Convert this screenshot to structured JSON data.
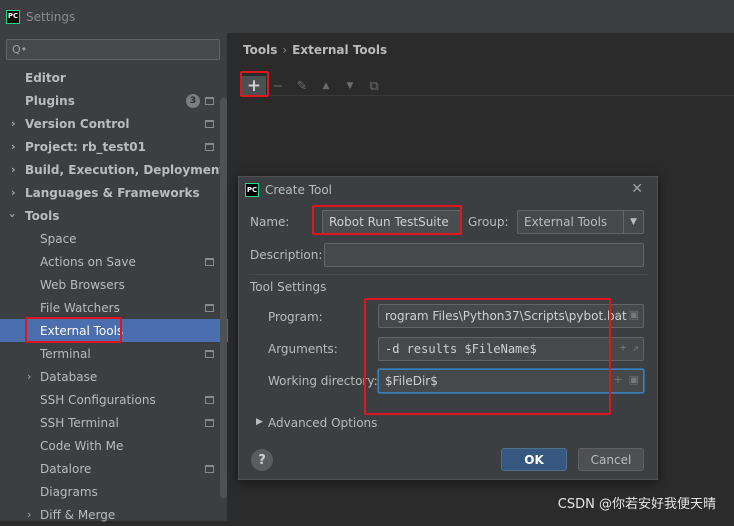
{
  "window": {
    "title": "Settings",
    "logo_text": "PC"
  },
  "search": {
    "placeholder": "Q•"
  },
  "sidebar": {
    "items": [
      {
        "label": "Editor"
      },
      {
        "label": "Plugins",
        "badge": "3"
      },
      {
        "label": "Version Control"
      },
      {
        "label": "Project: rb_test01"
      },
      {
        "label": "Build, Execution, Deployment"
      },
      {
        "label": "Languages & Frameworks"
      },
      {
        "label": "Tools"
      },
      {
        "label": "Space"
      },
      {
        "label": "Actions on Save"
      },
      {
        "label": "Web Browsers"
      },
      {
        "label": "File Watchers"
      },
      {
        "label": "External Tools"
      },
      {
        "label": "Terminal"
      },
      {
        "label": "Database"
      },
      {
        "label": "SSH Configurations"
      },
      {
        "label": "SSH Terminal"
      },
      {
        "label": "Code With Me"
      },
      {
        "label": "Datalore"
      },
      {
        "label": "Diagrams"
      },
      {
        "label": "Diff & Merge"
      }
    ]
  },
  "breadcrumb": {
    "parent": "Tools",
    "separator": "›",
    "current": "External Tools"
  },
  "toolbar": {
    "add": "+",
    "remove": "−",
    "edit": "✎",
    "up": "▲",
    "down": "▼",
    "copy": "⧉"
  },
  "dialog": {
    "title": "Create Tool",
    "close": "✕",
    "name_label": "Name:",
    "name_value": "Robot Run TestSuite",
    "group_label": "Group:",
    "group_value": "External Tools",
    "description_label": "Description:",
    "description_value": "",
    "tool_settings_label": "Tool Settings",
    "program_label": "Program:",
    "program_value": "rogram Files\\Python37\\Scripts\\pybot.bat",
    "arguments_label": "Arguments:",
    "arguments_value": "-d results $FileName$",
    "workdir_label": "Working directory:",
    "workdir_value": "$FileDir$",
    "advanced_label": "Advanced Options",
    "help": "?",
    "ok": "OK",
    "cancel": "Cancel"
  },
  "watermark": "CSDN @你若安好我便天晴"
}
